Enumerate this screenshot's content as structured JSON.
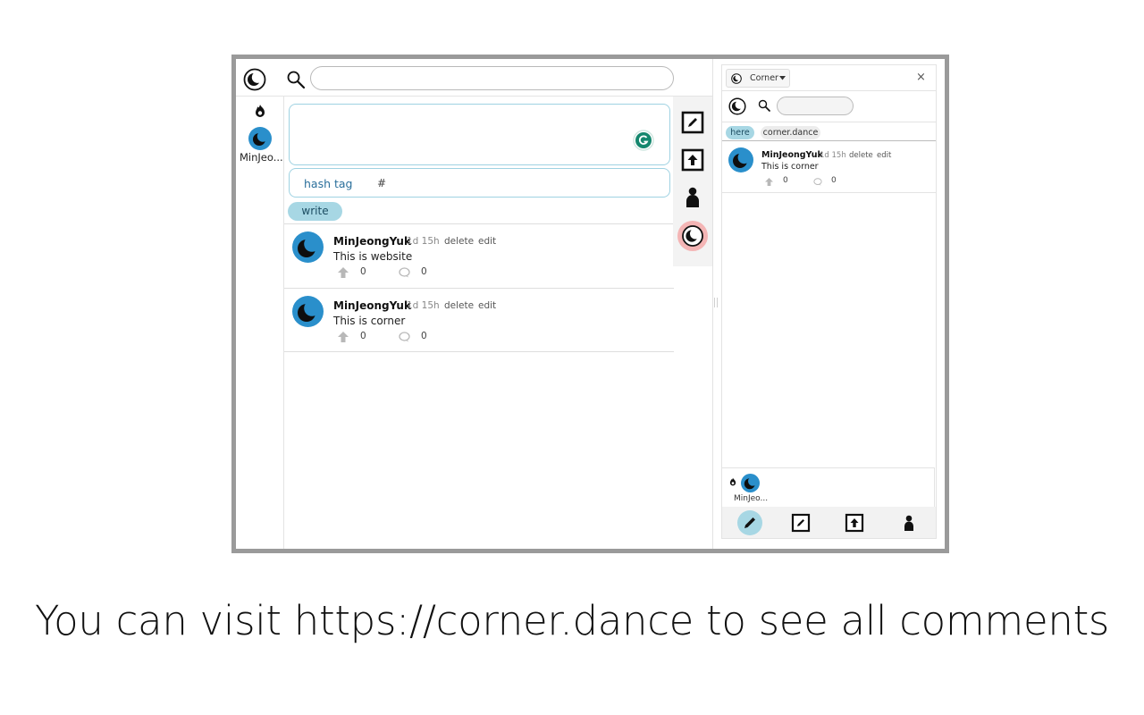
{
  "app": {
    "left_user": {
      "name": "MinJeo..."
    },
    "hashtag": {
      "label": "hash tag",
      "prefix": "#"
    },
    "write_label": "write",
    "posts": [
      {
        "author": "MinJeongYuk",
        "age": "1d 15h",
        "delete": "delete",
        "edit": "edit",
        "body": "This is website",
        "upvotes": "0",
        "comments": "0"
      },
      {
        "author": "MinJeongYuk",
        "age": "1d 15h",
        "delete": "delete",
        "edit": "edit",
        "body": "This is corner",
        "upvotes": "0",
        "comments": "0"
      }
    ]
  },
  "panel": {
    "dropdown_label": "Corner",
    "close": "×",
    "tabs": [
      "here",
      "corner.dance"
    ],
    "post": {
      "author": "MinJeongYuk",
      "age": "1d 15h",
      "delete": "delete",
      "edit": "edit",
      "body": "This is corner",
      "upvotes": "0",
      "comments": "0"
    },
    "user": {
      "name": "MinJeo..."
    }
  },
  "caption": "You can visit https://corner.dance to see all comments",
  "colors": {
    "brand_blue": "#2a8fcb",
    "accent_teal": "#a7d7e4",
    "active_pink": "#f4b5b5",
    "grammarly_green": "#15876e"
  },
  "icons": [
    "moon-icon",
    "search-icon",
    "fire-icon",
    "grammarly-icon",
    "pencil-box-icon",
    "upload-box-icon",
    "person-icon",
    "pencil-icon",
    "upvote-icon",
    "comment-icon",
    "close-icon"
  ]
}
